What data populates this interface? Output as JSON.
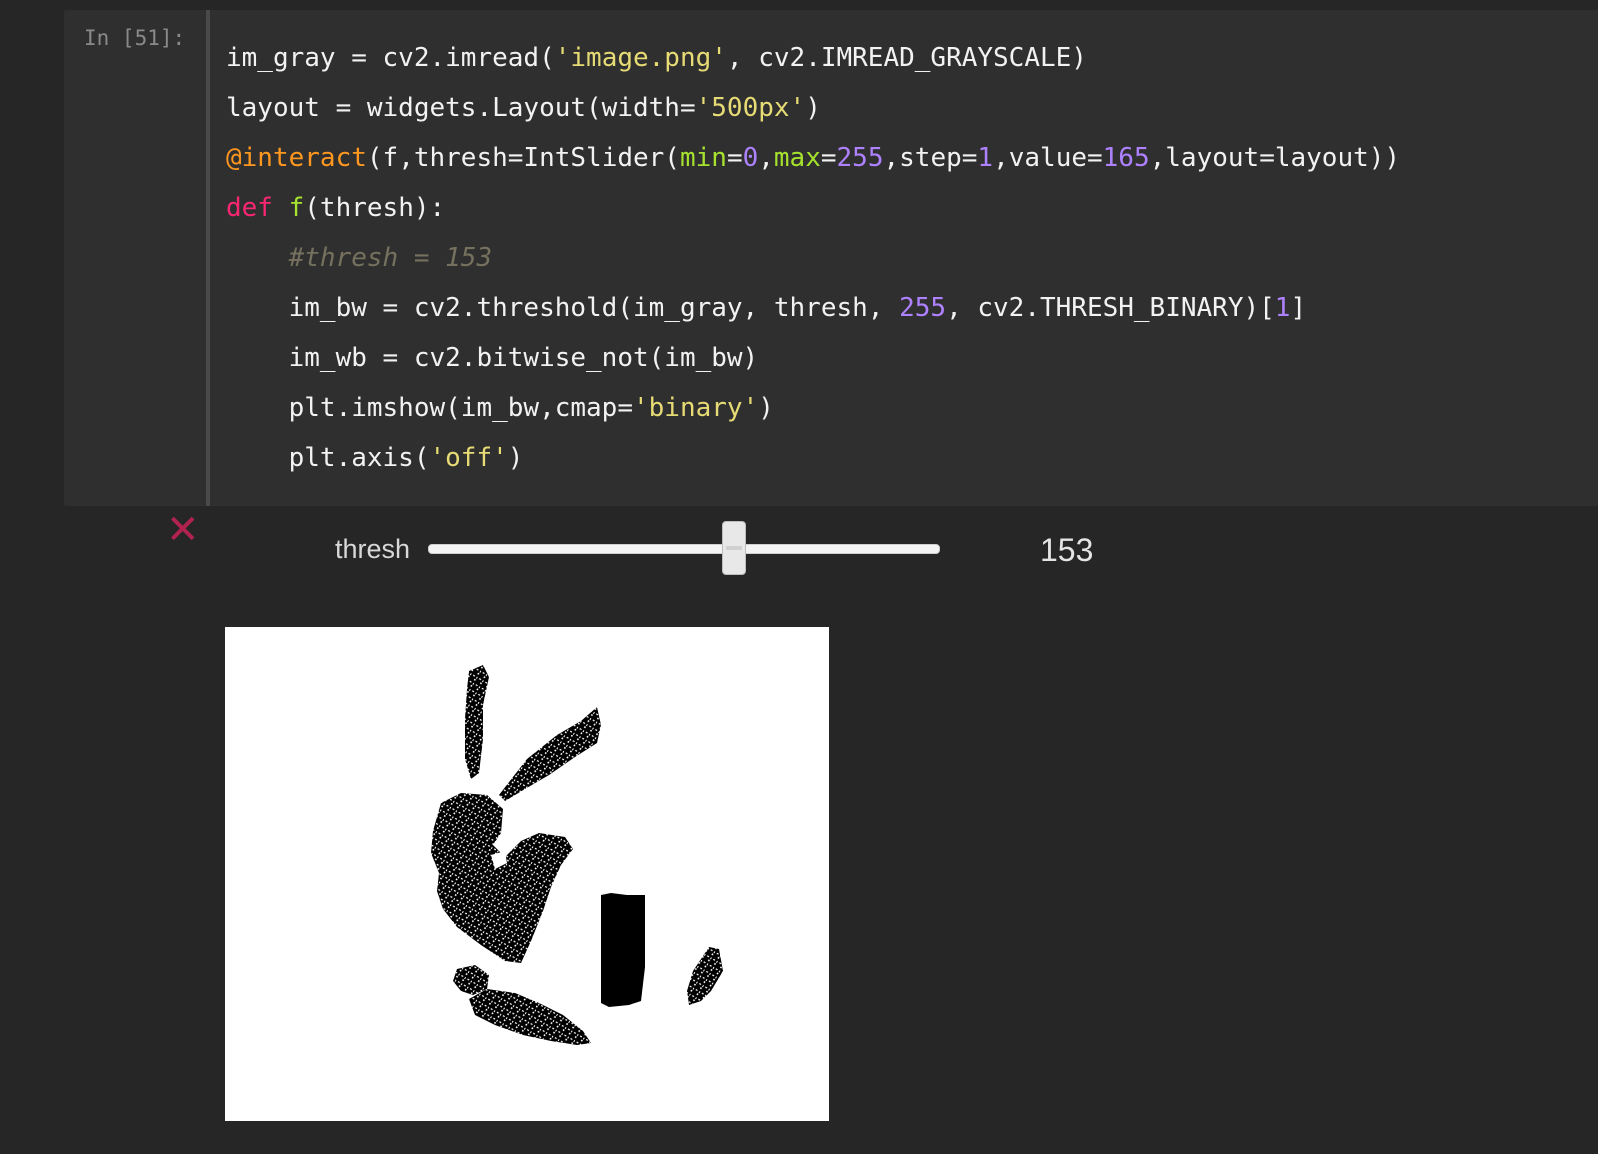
{
  "cell": {
    "prompt": "In [51]:",
    "lines": [
      [
        {
          "t": "plain",
          "s": "im_gray = cv2.imread("
        },
        {
          "t": "str",
          "s": "'image.png'"
        },
        {
          "t": "plain",
          "s": ", cv2.IMREAD_GRAYSCALE)"
        }
      ],
      [
        {
          "t": "plain",
          "s": "layout = widgets.Layout(width="
        },
        {
          "t": "str",
          "s": "'500px'"
        },
        {
          "t": "plain",
          "s": ")"
        }
      ],
      [
        {
          "t": "deco",
          "s": "@interact"
        },
        {
          "t": "plain",
          "s": "(f,thresh=IntSlider("
        },
        {
          "t": "arg",
          "s": "min"
        },
        {
          "t": "plain",
          "s": "="
        },
        {
          "t": "num",
          "s": "0"
        },
        {
          "t": "plain",
          "s": ","
        },
        {
          "t": "arg",
          "s": "max"
        },
        {
          "t": "plain",
          "s": "="
        },
        {
          "t": "num",
          "s": "255"
        },
        {
          "t": "plain",
          "s": ",step="
        },
        {
          "t": "num",
          "s": "1"
        },
        {
          "t": "plain",
          "s": ",value="
        },
        {
          "t": "num",
          "s": "165"
        },
        {
          "t": "plain",
          "s": ",layout=layout))"
        }
      ],
      [
        {
          "t": "kw",
          "s": "def"
        },
        {
          "t": "plain",
          "s": " "
        },
        {
          "t": "def",
          "s": "f"
        },
        {
          "t": "plain",
          "s": "(thresh):"
        }
      ],
      [
        {
          "t": "plain",
          "s": "    "
        },
        {
          "t": "com",
          "s": "#thresh = 153"
        }
      ],
      [
        {
          "t": "plain",
          "s": "    im_bw = cv2.threshold(im_gray, thresh, "
        },
        {
          "t": "num",
          "s": "255"
        },
        {
          "t": "plain",
          "s": ", cv2.THRESH_BINARY)["
        },
        {
          "t": "num",
          "s": "1"
        },
        {
          "t": "plain",
          "s": "]"
        }
      ],
      [
        {
          "t": "plain",
          "s": "    im_wb = cv2.bitwise_not(im_bw)"
        }
      ],
      [
        {
          "t": "plain",
          "s": "    plt.imshow(im_bw,cmap="
        },
        {
          "t": "str",
          "s": "'binary'"
        },
        {
          "t": "plain",
          "s": ")"
        }
      ],
      [
        {
          "t": "plain",
          "s": "    plt.axis("
        },
        {
          "t": "str",
          "s": "'off'"
        },
        {
          "t": "plain",
          "s": ")"
        }
      ]
    ]
  },
  "widget": {
    "close_glyph": "✕",
    "label": "thresh",
    "value": "153",
    "min": 0,
    "max": 255,
    "fraction": 0.6
  },
  "colors": {
    "background": "#262626",
    "string": "#e6db74",
    "number": "#ae81ff",
    "keyword": "#f92672",
    "function": "#a6e22e",
    "decorator": "#fd971f",
    "comment": "#75715e",
    "close": "#b0234f"
  },
  "icons": {
    "close": "close-icon",
    "plot": "binary-image-plot"
  }
}
